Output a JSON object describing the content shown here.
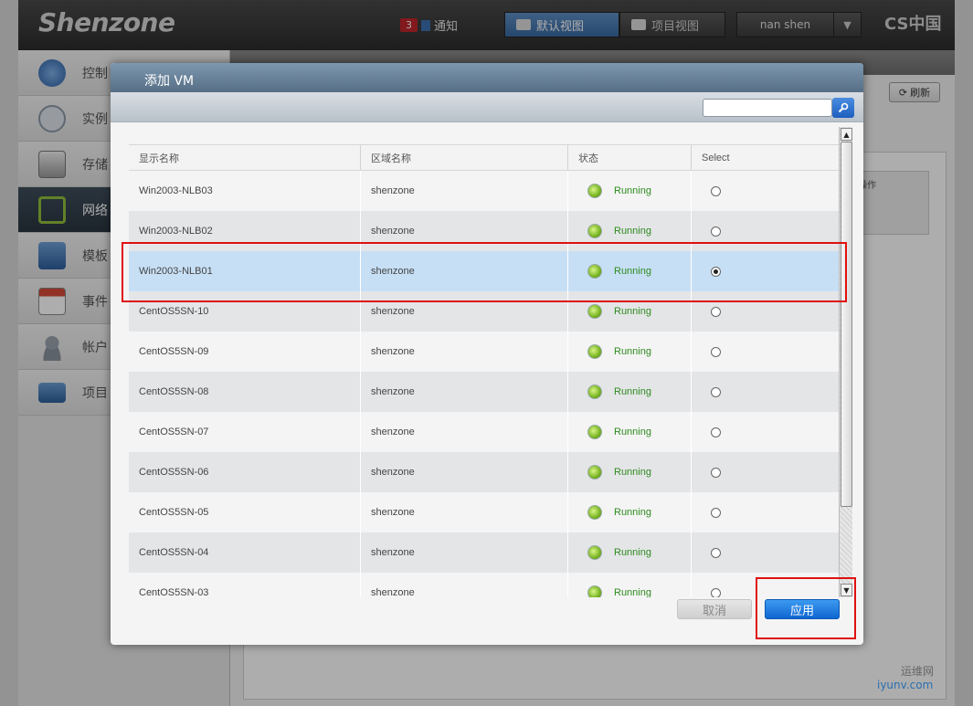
{
  "header": {
    "logo": "Shenzone",
    "notification_count": "3",
    "notification_label": "通知",
    "default_view": "默认视图",
    "project_view": "项目视图",
    "user_name": "nan shen",
    "brand": "CS中国"
  },
  "sidebar": {
    "items": [
      {
        "label": "控制",
        "icon": "dashboard-icon"
      },
      {
        "label": "实例",
        "icon": "cloud-icon"
      },
      {
        "label": "存储",
        "icon": "storage-icon"
      },
      {
        "label": "网络",
        "icon": "network-icon"
      },
      {
        "label": "模板",
        "icon": "template-icon"
      },
      {
        "label": "事件",
        "icon": "calendar-icon"
      },
      {
        "label": "帐户",
        "icon": "user-icon"
      },
      {
        "label": "项目",
        "icon": "folder-icon"
      }
    ]
  },
  "main": {
    "refresh_label": "刷新",
    "op_label": "操作"
  },
  "dialog": {
    "title": "添加 VM",
    "search": {
      "value": "",
      "placeholder": ""
    },
    "columns": [
      "显示名称",
      "区域名称",
      "状态",
      "Select"
    ],
    "rows": [
      {
        "name": "Win2003-NLB03",
        "zone": "shenzone",
        "state": "Running",
        "selected": false
      },
      {
        "name": "Win2003-NLB02",
        "zone": "shenzone",
        "state": "Running",
        "selected": false
      },
      {
        "name": "Win2003-NLB01",
        "zone": "shenzone",
        "state": "Running",
        "selected": true
      },
      {
        "name": "CentOS5SN-10",
        "zone": "shenzone",
        "state": "Running",
        "selected": false
      },
      {
        "name": "CentOS5SN-09",
        "zone": "shenzone",
        "state": "Running",
        "selected": false
      },
      {
        "name": "CentOS5SN-08",
        "zone": "shenzone",
        "state": "Running",
        "selected": false
      },
      {
        "name": "CentOS5SN-07",
        "zone": "shenzone",
        "state": "Running",
        "selected": false
      },
      {
        "name": "CentOS5SN-06",
        "zone": "shenzone",
        "state": "Running",
        "selected": false
      },
      {
        "name": "CentOS5SN-05",
        "zone": "shenzone",
        "state": "Running",
        "selected": false
      },
      {
        "name": "CentOS5SN-04",
        "zone": "shenzone",
        "state": "Running",
        "selected": false
      },
      {
        "name": "CentOS5SN-03",
        "zone": "shenzone",
        "state": "Running",
        "selected": false
      }
    ],
    "cancel_label": "取消",
    "apply_label": "应用"
  },
  "watermark": {
    "line1": "运维网",
    "line2": "iyunv.com"
  },
  "colors": {
    "accent": "#1d6fd6",
    "running": "#2e8b1f",
    "highlight": "#e01010",
    "selected_row": "#c7dff5"
  }
}
